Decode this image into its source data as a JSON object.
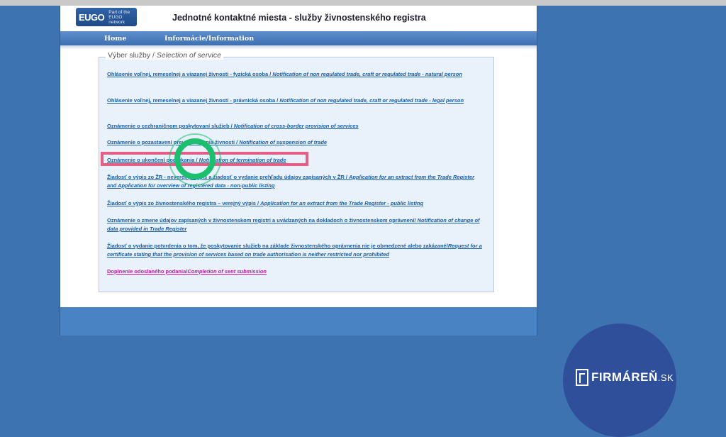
{
  "logo": {
    "text": "EUGO",
    "subtitle": "Part of the EUGO network"
  },
  "header": {
    "title": "Jednotné kontaktné miesta - služby živnostenského registra"
  },
  "nav": {
    "home": "Home",
    "info": "Informácie/Information"
  },
  "fieldset": {
    "legend_sk": "Výber služby / ",
    "legend_en": "Selection of service"
  },
  "services": [
    {
      "sk": "Ohlásenie voľnej, remeselnej a viazanej živnosti - fyzická osoba / ",
      "en": "Notification of non regulated trade, craft or regulated trade - natural person"
    },
    {
      "sk": "Ohlásenie voľnej, remeselnej a viazanej živnosti - právnická osoba / ",
      "en": "Notification of non regulated trade, craft or regulated trade - legal person"
    },
    {
      "sk": "Oznámenie o cezhraničnom poskytovaní služieb / ",
      "en": "Notification of cross-border provision of services"
    },
    {
      "sk": "Oznámenie o pozastavení prevádzkovania živnosti / ",
      "en": "Notification of suspension of trade"
    },
    {
      "sk": "Oznámenie o ukončení podnikania / ",
      "en": "Notification of termination of trade"
    },
    {
      "sk": "Žiadosť o výpis zo ŽR - neverejný výpis a žiadosť o vydanie prehľadu údajov zapísaných v ŽR / ",
      "en": "Application for an extract from the Trade Register and Application for overview of registered data - non-public listing"
    },
    {
      "sk": "Žiadosť o výpis zo živnostenského registra – verejný výpis / ",
      "en": "Application for an extract from the Trade Register - public listing"
    },
    {
      "sk": "Oznámenie o zmene údajov zapísaných v živnostenskom registri a uvádzaných na dokladoch o živnostenskom oprávnení/ ",
      "en": "Notification of change of data provided in Trade Register"
    },
    {
      "sk": "Žiadosť o vydanie potvrdenia o tom, že poskytovanie služieb na základe živnostenského oprávnenia nie je obmedzené alebo zakázané/",
      "en": "Request for a certificate stating that the provision of services based on trade authorisation is neither restricted nor prohibited"
    },
    {
      "sk": "Doplnenie odoslaného podania/",
      "en": "Completion of sent submission"
    }
  ],
  "brand": {
    "name": "FIRMÁREŇ",
    "tld": ".SK"
  },
  "colors": {
    "link": "#1a5ea8",
    "link_special": "#c2199c",
    "highlight": "#e25f86",
    "click_ring": "#1cbf6e"
  }
}
